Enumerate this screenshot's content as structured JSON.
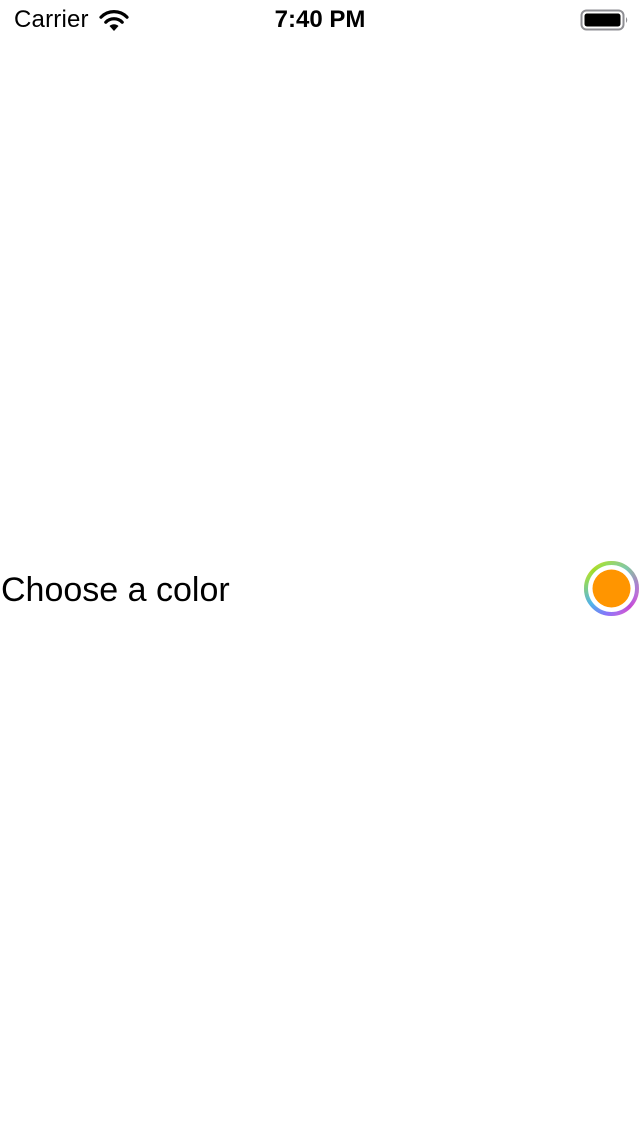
{
  "status_bar": {
    "carrier": "Carrier",
    "time": "7:40 PM",
    "wifi_icon": "wifi-icon",
    "battery_icon": "battery-icon"
  },
  "color_picker_row": {
    "label": "Choose a color",
    "selected_color": "#FF9500"
  },
  "colors": {
    "background": "#FFFFFF",
    "text": "#000000",
    "swatch": "#FF9500"
  }
}
